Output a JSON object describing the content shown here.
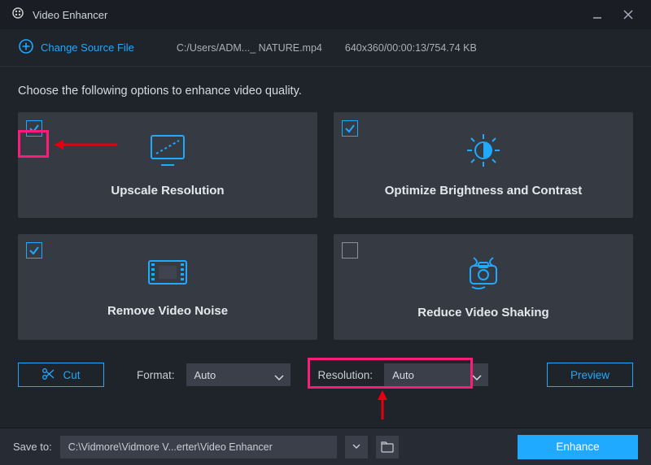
{
  "app": {
    "title": "Video Enhancer"
  },
  "top": {
    "change_source_label": "Change Source File",
    "file_path": "C:/Users/ADM..._ NATURE.mp4",
    "file_meta": "640x360/00:00:13/754.74 KB"
  },
  "instruction": "Choose the following options to enhance video quality.",
  "cards": {
    "upscale": {
      "label": "Upscale Resolution",
      "checked": true
    },
    "brightness": {
      "label": "Optimize Brightness and Contrast",
      "checked": true
    },
    "noise": {
      "label": "Remove Video Noise",
      "checked": true
    },
    "shaking": {
      "label": "Reduce Video Shaking",
      "checked": false
    }
  },
  "toolbar": {
    "cut_label": "Cut",
    "format_label": "Format:",
    "format_value": "Auto",
    "resolution_label": "Resolution:",
    "resolution_value": "Auto",
    "preview_label": "Preview"
  },
  "save": {
    "label": "Save to:",
    "path": "C:\\Vidmore\\Vidmore V...erter\\Video Enhancer",
    "enhance_label": "Enhance"
  }
}
